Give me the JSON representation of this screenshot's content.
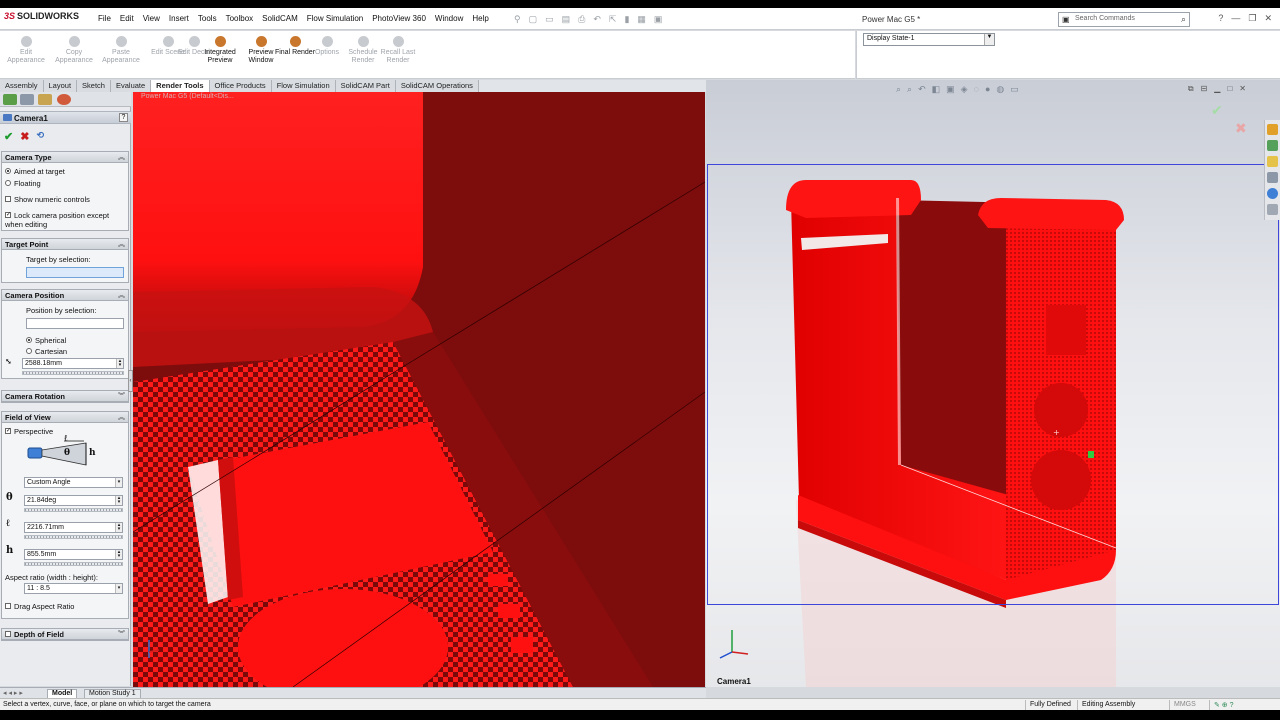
{
  "app": {
    "brand": "SOLIDWORKS",
    "brand_prefix": "3S",
    "document_title": "Power Mac G5 *",
    "search_placeholder": "Search Commands"
  },
  "menu": [
    "File",
    "Edit",
    "View",
    "Insert",
    "Tools",
    "Toolbox",
    "SolidCAM",
    "Flow Simulation",
    "PhotoView 360",
    "Window",
    "Help"
  ],
  "ribbon": {
    "buttons": [
      {
        "label": "Edit Appearance",
        "enabled": false
      },
      {
        "label": "Copy Appearance",
        "enabled": false
      },
      {
        "label": "Paste Appearance",
        "enabled": false
      },
      {
        "label": "Edit Scene",
        "enabled": false
      },
      {
        "label": "Edit Decal",
        "enabled": false
      },
      {
        "label": "Integrated Preview",
        "enabled": true
      },
      {
        "label": "Preview Window",
        "enabled": true
      },
      {
        "label": "Final Render",
        "enabled": true
      },
      {
        "label": "Options",
        "enabled": false
      },
      {
        "label": "Schedule Render",
        "enabled": false
      },
      {
        "label": "Recall Last Render",
        "enabled": false
      }
    ],
    "display_state": "Display State-1"
  },
  "tabs": [
    {
      "label": "Assembly",
      "active": false
    },
    {
      "label": "Layout",
      "active": false
    },
    {
      "label": "Sketch",
      "active": false
    },
    {
      "label": "Evaluate",
      "active": false
    },
    {
      "label": "Render Tools",
      "active": true
    },
    {
      "label": "Office Products",
      "active": false
    },
    {
      "label": "Flow Simulation",
      "active": false
    },
    {
      "label": "SolidCAM Part",
      "active": false
    },
    {
      "label": "SolidCAM Operations",
      "active": false
    }
  ],
  "property_manager": {
    "title": "Camera1",
    "help": "?",
    "camera_type": {
      "header": "Camera Type",
      "aimed": "Aimed at target",
      "floating": "Floating",
      "selected": "aimed",
      "show_numeric": "Show numeric controls",
      "show_numeric_checked": false,
      "lock_position": "Lock camera position except when editing",
      "lock_checked": true
    },
    "target_point": {
      "header": "Target Point",
      "label": "Target by selection:",
      "value": ""
    },
    "camera_position": {
      "header": "Camera Position",
      "label": "Position by selection:",
      "value": "",
      "spherical": "Spherical",
      "cartesian": "Cartesian",
      "selected": "spherical",
      "distance": "2588.18mm"
    },
    "camera_rotation": {
      "header": "Camera Rotation"
    },
    "field_of_view": {
      "header": "Field of View",
      "perspective": "Perspective",
      "perspective_checked": true,
      "preset": "Custom Angle",
      "angle": "21.84deg",
      "distance": "2216.71mm",
      "height": "855.5mm",
      "symbols": {
        "angle": "θ",
        "distance": "ℓ",
        "height": "h"
      },
      "aspect_label": "Aspect ratio (width : height):",
      "aspect_value": "11 : 8.5",
      "drag_aspect": "Drag Aspect Ratio",
      "drag_checked": false
    },
    "depth_of_field": {
      "header": "Depth of Field",
      "checked": false
    }
  },
  "viewport_left": {
    "header": "Power Mac G5 (Default<Dis..."
  },
  "viewport_right": {
    "label": "Camera1"
  },
  "bottom_tabs": [
    {
      "label": "Model",
      "active": true
    },
    {
      "label": "Motion Study 1",
      "active": false
    }
  ],
  "status": {
    "message": "Select a vertex, curve, face, or plane on which to target the camera",
    "fields": [
      "Fully Defined",
      "Editing Assembly",
      "MMGS"
    ]
  },
  "colors": {
    "model_red": "#ff0000",
    "dark_red": "#7a0f0f",
    "accent_blue": "#3d46d8"
  }
}
